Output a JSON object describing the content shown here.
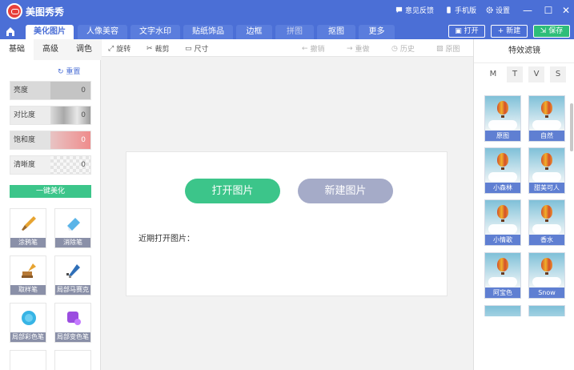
{
  "app": {
    "title": "美图秀秀"
  },
  "titlebar": {
    "feedback": "意见反馈",
    "mobile": "手机版",
    "settings": "设置"
  },
  "nav": {
    "tabs": [
      "美化图片",
      "人像美容",
      "文字水印",
      "贴纸饰品",
      "边框",
      "拼图",
      "抠图",
      "更多"
    ],
    "open": "打开",
    "new": "新建",
    "save": "保存"
  },
  "left": {
    "subtabs": [
      "基础",
      "高级",
      "调色"
    ],
    "reset": "重置",
    "sliders": [
      {
        "label": "亮度",
        "value": "0"
      },
      {
        "label": "对比度",
        "value": "0"
      },
      {
        "label": "饱和度",
        "value": "0"
      },
      {
        "label": "清晰度",
        "value": "0"
      }
    ],
    "one_key": "一键美化",
    "tools": [
      "涂鸦笔",
      "消除笔",
      "取样笔",
      "局部马赛克",
      "局部彩色笔",
      "局部变色笔"
    ]
  },
  "toolbar": {
    "rotate": "旋转",
    "crop": "裁剪",
    "size": "尺寸",
    "undo": "撤销",
    "redo": "重做",
    "history": "历史",
    "original": "原图"
  },
  "start": {
    "open_image": "打开图片",
    "new_image": "新建图片",
    "recent": "近期打开图片："
  },
  "right": {
    "title": "特效滤镜",
    "categories": [
      "M",
      "T",
      "V",
      "S"
    ],
    "filters": [
      "原图",
      "自然",
      "小森林",
      "甜美可人",
      "小情歌",
      "香水",
      "阿宝色",
      "Snow"
    ]
  },
  "colors": {
    "primary": "#4b6fd6",
    "green": "#3cc58a",
    "gray_btn": "#a5abc8"
  }
}
